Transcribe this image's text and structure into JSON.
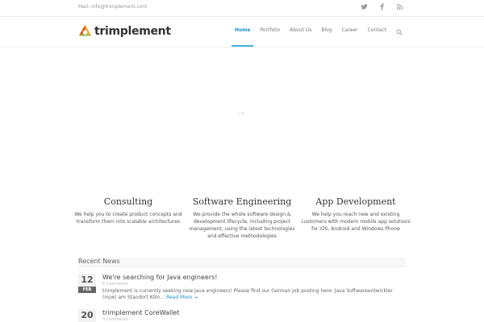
{
  "topbar": {
    "mail": "Mail: info@trimplement.com",
    "social": [
      {
        "icon": "twitter-icon"
      },
      {
        "icon": "facebook-icon"
      },
      {
        "icon": "rss-icon"
      }
    ]
  },
  "header": {
    "logo_text": "trimplement",
    "nav": [
      {
        "label": "Home",
        "active": true
      },
      {
        "label": "Portfolio"
      },
      {
        "label": "About Us"
      },
      {
        "label": "Blog"
      },
      {
        "label": "Career"
      },
      {
        "label": "Contact"
      }
    ],
    "accent": "#3db2e5"
  },
  "services": [
    {
      "title": "Consulting",
      "text": "We help you to create product concepts and transform them into scalable architectures"
    },
    {
      "title": "Software Engineering",
      "text": "We provide the whole software design & development lifecycle, including project management, using the latest technologies and effective methodologies"
    },
    {
      "title": "App Development",
      "text": "We help you reach new and existing customers with modern mobile app solutions for iOS, Android and Windows Phone"
    }
  ],
  "recent": {
    "heading": "Recent News",
    "items": [
      {
        "day": "12",
        "month": "FEB",
        "title": "We're searching for Java engineers!",
        "comments": "0 Comments",
        "excerpt": "trimplement is currently seeking new Java engineers! Please find our German job posting here: Java Softwareentwickler (m/w) am Standort Köln...",
        "more": "Read More →"
      },
      {
        "day": "20",
        "month": "",
        "title": "trimplement CoreWallet",
        "comments": "0 Comments",
        "excerpt": "",
        "more": ""
      }
    ]
  }
}
